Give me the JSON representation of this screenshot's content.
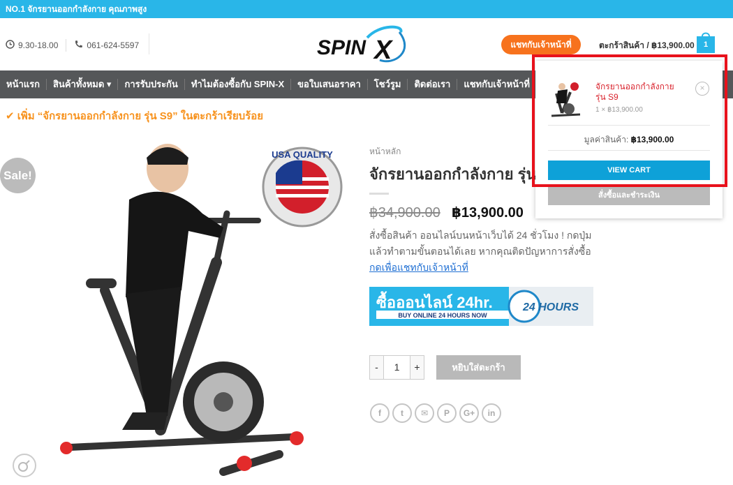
{
  "topbar": {
    "text": "NO.1 จักรยานออกกำลังกาย คุณภาพสูง"
  },
  "header": {
    "hours": "9.30-18.00",
    "phone": "061-624-5597",
    "logo_text": "SPINX",
    "chat_button": "แชทกับเจ้าหน้าที่",
    "cart_label": "ตะกร้าสินค้า / ฿13,900.00",
    "cart_count": "1"
  },
  "nav": {
    "items": [
      {
        "label": "หน้าแรก"
      },
      {
        "label": "สินค้าทั้งหมด ▾"
      },
      {
        "label": "การรับประกัน"
      },
      {
        "label": "ทำไมต้องซื้อกับ SPIN-X"
      },
      {
        "label": "ขอใบเสนอราคา"
      },
      {
        "label": "โชว์รูม"
      },
      {
        "label": "ติดต่อเรา"
      },
      {
        "label": "แชทกับเจ้าหน้าที่"
      }
    ]
  },
  "notice": {
    "text": "✔ เพิ่ม “จักรยานออกกำลังกาย รุ่น S9” ในตะกร้าเรียบร้อย"
  },
  "product": {
    "sale_badge": "Sale!",
    "quality_badge": "USA QUALITY",
    "breadcrumb": "หน้าหลัก",
    "title": "จักรยานออกกำลังกาย รุ่น S9",
    "old_price": "฿34,900.00",
    "price": "฿13,900.00",
    "desc_line": "สั่งซื้อสินค้า ออนไลน์บนหน้าเว็บได้ 24 ชั่วโมง ! กดปุ่ม แล้วทำตามขั้นตอนได้เลย หากคุณติดปัญหาการสั่งซื้อ",
    "desc_link": "กดเพื่อแชทกับเจ้าหน้าที่",
    "banner_text": "ซื้อออนไลน์ 24hr.",
    "banner_sub": "BUY ONLINE 24 HOURS NOW",
    "banner_badge": "24 HOURS",
    "qty_minus": "-",
    "qty_value": "1",
    "qty_plus": "+",
    "add_to_cart": "หยิบใส่ตะกร้า",
    "share_icons": [
      "f",
      "t",
      "✉",
      "P",
      "G+",
      "in"
    ]
  },
  "mini_cart": {
    "item_name": "จักรยานออกกำลังกาย รุ่น S9",
    "item_qty": "1 × ฿13,900.00",
    "remove": "×",
    "subtotal_label": "มูลค่าสินค้า:",
    "subtotal_value": "฿13,900.00",
    "view_cart": "VIEW CART",
    "checkout": "สั่งซื้อและชำระเงิน"
  },
  "colors": {
    "topbar": "#29b6e8",
    "nav": "#555759",
    "accent_orange": "#f7721d",
    "view_cart": "#0ea1d8",
    "highlight": "#e8121c"
  }
}
